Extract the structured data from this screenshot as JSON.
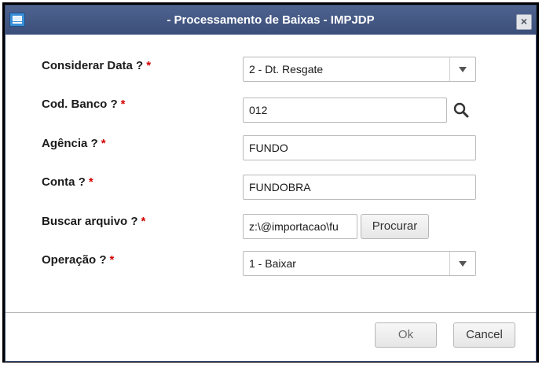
{
  "window": {
    "title": "- Processamento de Baixas - IMPJDP",
    "close_label": "×"
  },
  "form": {
    "required_marker": "*",
    "considerar_data": {
      "label": "Considerar Data ?",
      "value": "2 - Dt. Resgate"
    },
    "cod_banco": {
      "label": "Cod. Banco ?",
      "value": "012"
    },
    "agencia": {
      "label": "Agência ?",
      "value": "FUNDO"
    },
    "conta": {
      "label": "Conta ?",
      "value": "FUNDOBRA"
    },
    "buscar_arquivo": {
      "label": "Buscar arquivo ?",
      "value": "z:\\@importacao\\fu",
      "browse_label": "Procurar"
    },
    "operacao": {
      "label": "Operação ?",
      "value": "1 - Baixar"
    }
  },
  "footer": {
    "ok_label": "Ok",
    "cancel_label": "Cancel"
  }
}
